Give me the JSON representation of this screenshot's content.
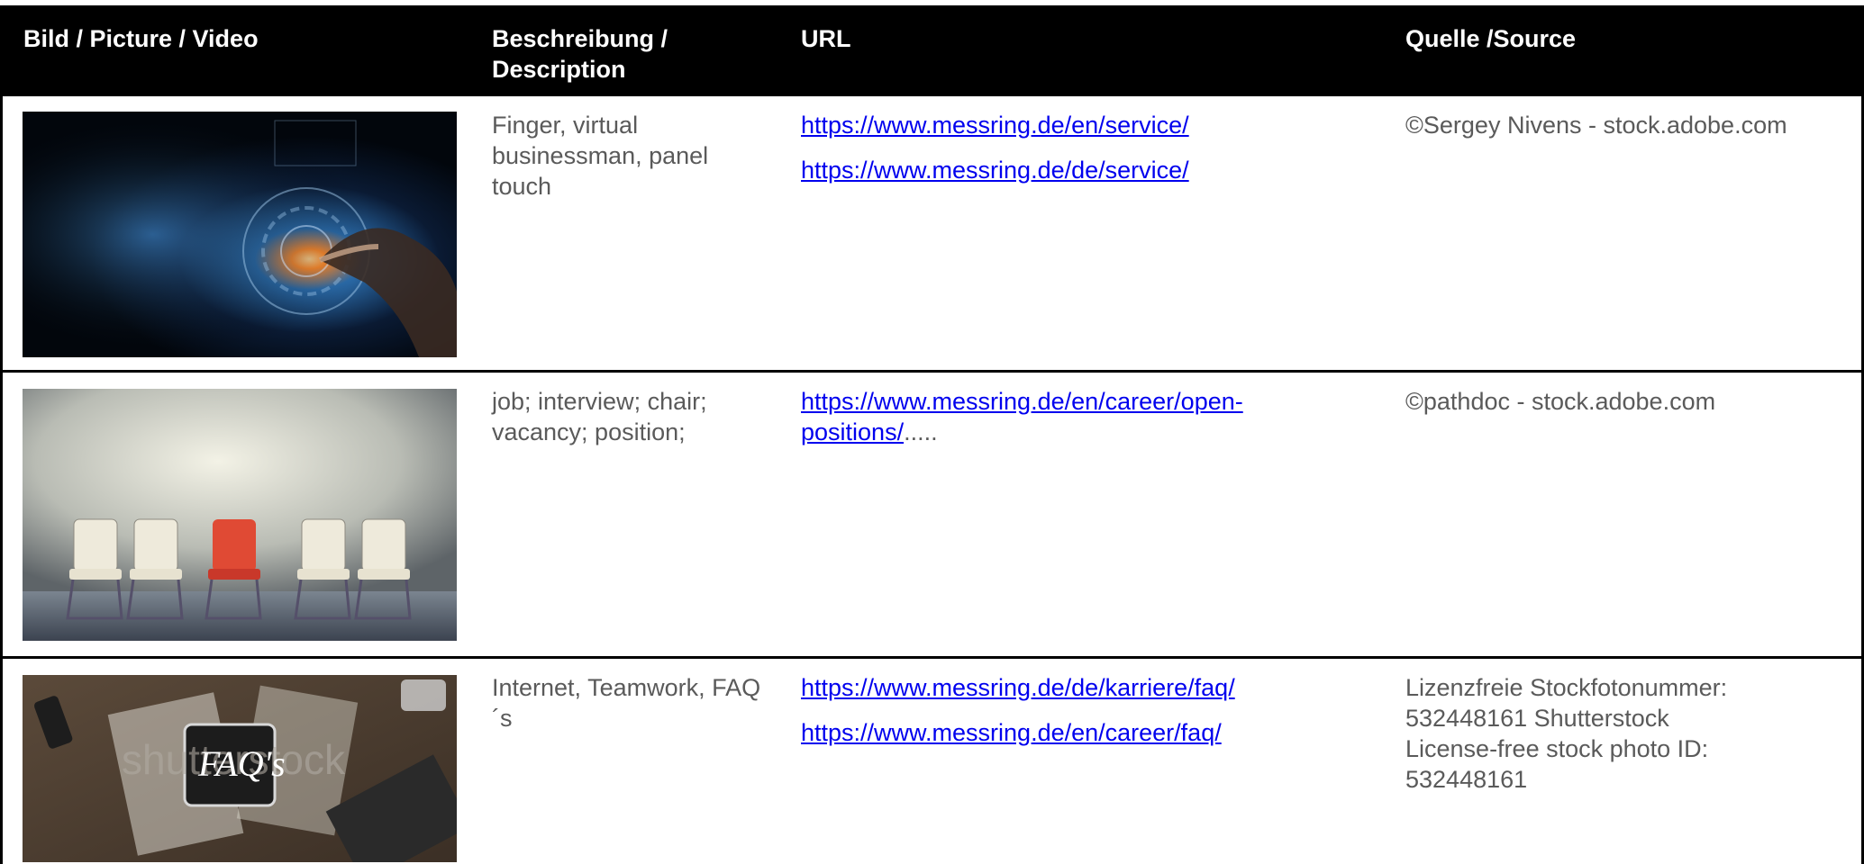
{
  "headers": {
    "picture": "Bild / Picture / Video",
    "description": "Beschreibung / Description",
    "url": "URL",
    "source": "Quelle /Source"
  },
  "rows": [
    {
      "description": "Finger, virtual businessman, panel touch",
      "urls": [
        "https://www.messring.de/en/service/",
        "https://www.messring.de/de/service/"
      ],
      "source": [
        "©Sergey Nivens - stock.adobe.com"
      ]
    },
    {
      "description": "job; interview; chair; vacancy; position;",
      "url_link": "https://www.messring.de/en/career/open-positions/",
      "url_tail": ".....",
      "source": [
        "©pathdoc - stock.adobe.com"
      ]
    },
    {
      "description": "Internet, Teamwork, FAQ´s",
      "urls": [
        "https://www.messring.de/de/karriere/faq/",
        "https://www.messring.de/en/career/faq/"
      ],
      "source": [
        "Lizenzfreie Stockfotonummer: 532448161 Shutterstock",
        "License-free stock photo ID: 532448161"
      ],
      "image_text": "FAQ's",
      "watermark": "shutterstock"
    }
  ],
  "colors": {
    "header_bg": "#000000",
    "link": "#0000ee",
    "text": "#5a5a5a"
  }
}
